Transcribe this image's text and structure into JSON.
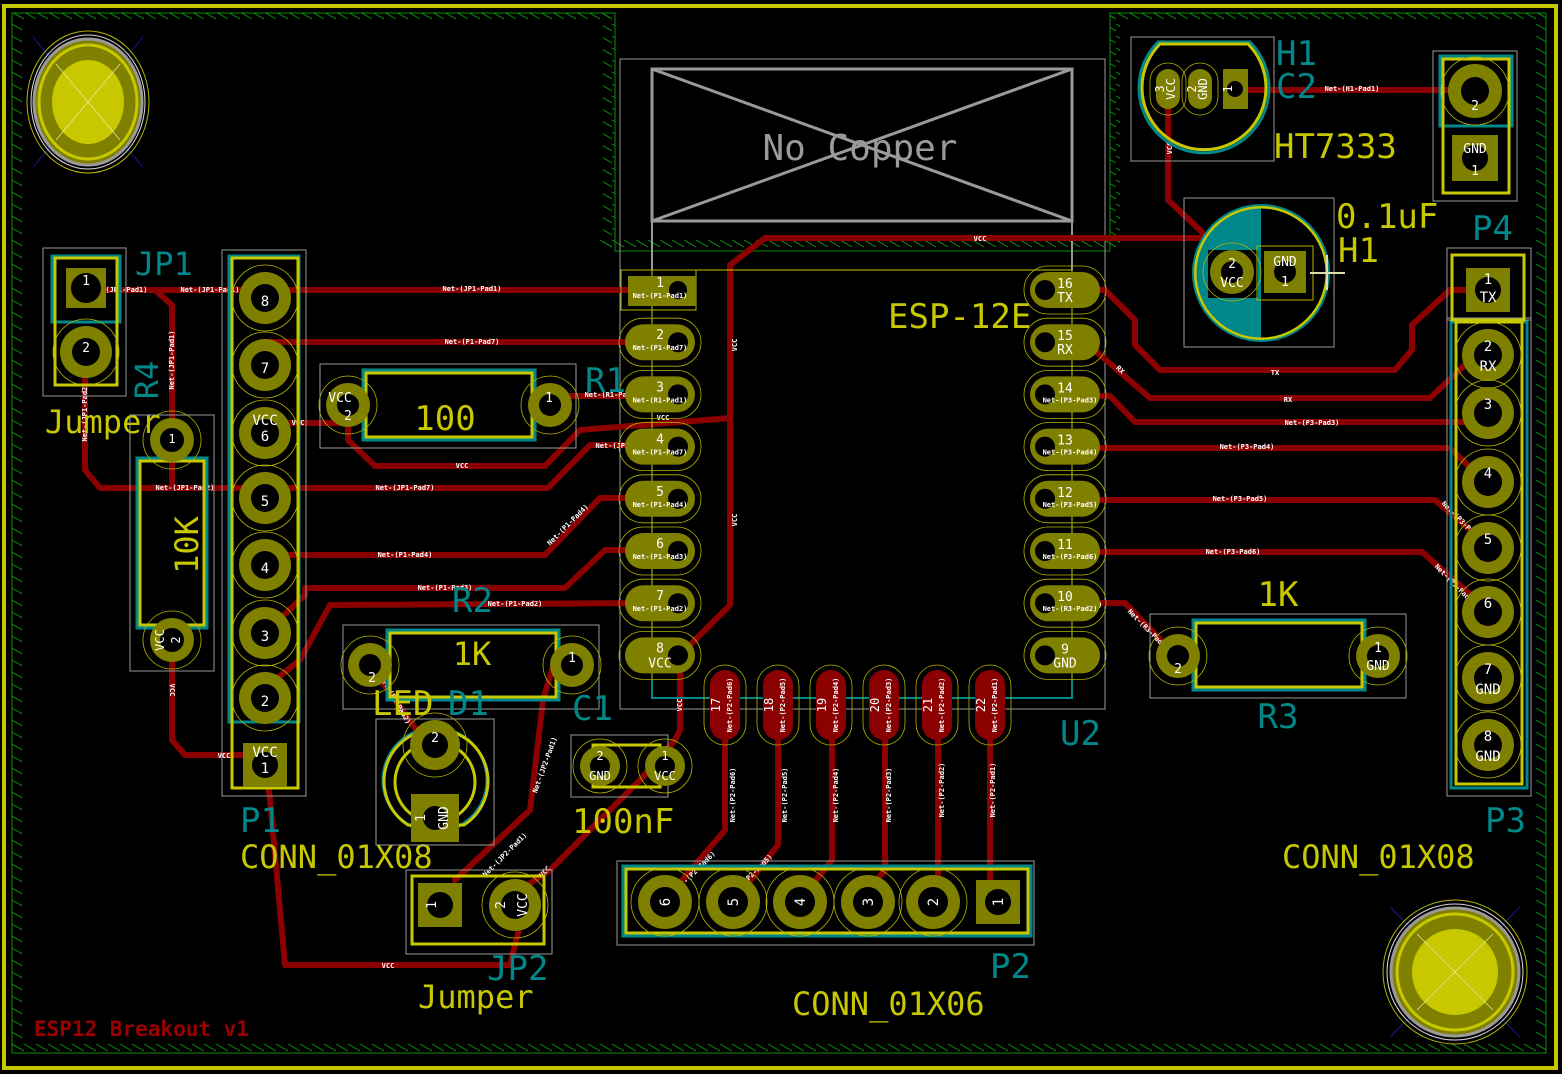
{
  "app": {
    "view": "PCB layout",
    "board_title": "ESP12 Breakout v1"
  },
  "colors": {
    "background": "#000000",
    "board_edge": "#c8c800",
    "keepout_hatch": "#0a8a0a",
    "trace": "#8b0000",
    "pad": "#7f7f00",
    "silkscreen": "#c8c800",
    "fab_outline": "#00878a",
    "courtyard": "#9a9a9a",
    "reference_text": "#00878a",
    "value_text": "#c8c800",
    "board_title_text": "#9b0000"
  },
  "keepout": {
    "label": "No Copper"
  },
  "components": {
    "U2": {
      "ref": "U2",
      "value": "ESP-12E",
      "left_pins": [
        {
          "num": "1",
          "net": "Net-(P1-Pad1)"
        },
        {
          "num": "2",
          "net": "Net-(P1-Pad7)"
        },
        {
          "num": "3",
          "net": "Net-(R1-Pad1)"
        },
        {
          "num": "4",
          "net": "Net-(P1-Pad7)"
        },
        {
          "num": "5",
          "net": "Net-(P1-Pad4)"
        },
        {
          "num": "6",
          "net": "Net-(P1-Pad3)"
        },
        {
          "num": "7",
          "net": "Net-(P1-Pad2)"
        },
        {
          "num": "8",
          "name": "VCC"
        }
      ],
      "right_pins": [
        {
          "num": "16",
          "name": "TX"
        },
        {
          "num": "15",
          "name": "RX"
        },
        {
          "num": "14",
          "net": "Net-(P3-Pad3)"
        },
        {
          "num": "13",
          "net": "Net-(P3-Pad4)"
        },
        {
          "num": "12",
          "net": "Net-(P3-Pad5)"
        },
        {
          "num": "11",
          "net": "Net-(P3-Pad6)"
        },
        {
          "num": "10",
          "net": "Net-(R3-Pad2)"
        },
        {
          "num": "9",
          "name": "GND"
        }
      ],
      "bottom_pins": [
        {
          "num": "17",
          "net": "Net-(P2-Pad6)"
        },
        {
          "num": "18",
          "net": "Net-(P2-Pad5)"
        },
        {
          "num": "19",
          "net": "Net-(P2-Pad4)"
        },
        {
          "num": "20",
          "net": "Net-(P2-Pad3)"
        },
        {
          "num": "21",
          "net": "Net-(P2-Pad2)"
        },
        {
          "num": "22",
          "net": "Net-(P2-Pad1)"
        }
      ]
    },
    "JP1": {
      "ref": "JP1",
      "value": "Jumper",
      "pins": [
        "1",
        "2"
      ]
    },
    "JP2": {
      "ref": "JP2",
      "value": "Jumper",
      "pins": [
        "1",
        "2"
      ],
      "pin2_name": "VCC"
    },
    "P1": {
      "ref": "P1",
      "value": "CONN_01X08",
      "pins": [
        "8",
        "7",
        "6",
        "5",
        "4",
        "3",
        "2",
        "1"
      ],
      "pin6_name": "VCC",
      "pin1_name": "VCC"
    },
    "P2": {
      "ref": "P2",
      "value": "CONN_01X06",
      "pins": [
        "6",
        "5",
        "4",
        "3",
        "2",
        "1"
      ]
    },
    "P3": {
      "ref": "P3",
      "value": "CONN_01X08",
      "pins": [
        {
          "num": "2",
          "name": "RX"
        },
        {
          "num": "3"
        },
        {
          "num": "4"
        },
        {
          "num": "5"
        },
        {
          "num": "6"
        },
        {
          "num": "7",
          "name": "GND"
        },
        {
          "num": "8",
          "name": "GND"
        }
      ]
    },
    "P4": {
      "ref": "P4",
      "pins": [
        {
          "num": "1",
          "name": "TX"
        }
      ]
    },
    "R1": {
      "ref": "R1",
      "value": "100",
      "pin1": "1",
      "pin2": "2",
      "pin2_name": "VCC"
    },
    "R2": {
      "ref": "R2",
      "value": "1K",
      "pin1": "1",
      "pin2": "2"
    },
    "R3": {
      "ref": "R3",
      "value": "1K",
      "pin1": "1",
      "pin1_name": "GND",
      "pin2": "2"
    },
    "R4": {
      "ref": "R4",
      "value": "10K",
      "pin1": "1",
      "pin2": "2",
      "pin2_name": "VCC"
    },
    "C1": {
      "ref": "C1",
      "value": "100nF",
      "pin1": "1",
      "pin1_name": "VCC",
      "pin2": "2",
      "pin2_name": "GND"
    },
    "C2": {
      "ref": "C2",
      "value": "0.1uF",
      "pin1": "1",
      "pin1_name": "GND",
      "pin2": "2",
      "pin2_name": "VCC"
    },
    "H1_reg": {
      "ref": "H1",
      "ref2": "C2",
      "value": "HT7333",
      "pins": [
        {
          "num": "3",
          "name": "VCC"
        },
        {
          "num": "2",
          "name": "GND"
        },
        {
          "num": "1"
        }
      ]
    },
    "H1_cap_ref": "H1",
    "D1": {
      "ref": "D1",
      "value": "LED",
      "pin1": "1",
      "pin1_name": "GND",
      "pin2": "2"
    },
    "PWR": {
      "pin1": "1",
      "pin1_name": "GND",
      "pin2": "2"
    }
  },
  "net_labels": {
    "vcc": "VCC",
    "tx": "TX",
    "rx": "RX",
    "jp1_pad1": "Net-(JP1-Pad1)",
    "jp1_pad2": "Net-(JP1-Pad2)",
    "p1_pad7": "Net-(P1-Pad7)",
    "jp1_pad7": "Net-(JP1-Pad7)",
    "p1_pad4": "Net-(P1-Pad4)",
    "p1_pad3": "Net-(P1-Pad3)",
    "p1_pad2": "Net-(P1-Pad2)",
    "r1_pad1": "Net-(R1-Pad1)",
    "h1_pad1": "Net-(H1-Pad1)",
    "p3_pad3": "Net-(P3-Pad3)",
    "p3_pad4": "Net-(P3-Pad4)",
    "p3_pad5": "Net-(P3-Pad5)",
    "p3_pad6": "Net-(P3-Pad6)",
    "r3_pad2": "Net-(R3-Pad2)",
    "jp2_pad1": "Net-(JP2-Pad1)",
    "d1_pad2": "Net-(D1-Pad2)",
    "p2_pad6": "Net-(P2-Pad6)",
    "p2_pad5": "Net-(P2-Pad5)",
    "p2_pad4": "Net-(P2-Pad4)",
    "p2_pad3": "Net-(P2-Pad3)",
    "p2_pad2": "Net-(P2-Pad2)",
    "p2_pad1": "Net-(P2-Pad1)"
  }
}
